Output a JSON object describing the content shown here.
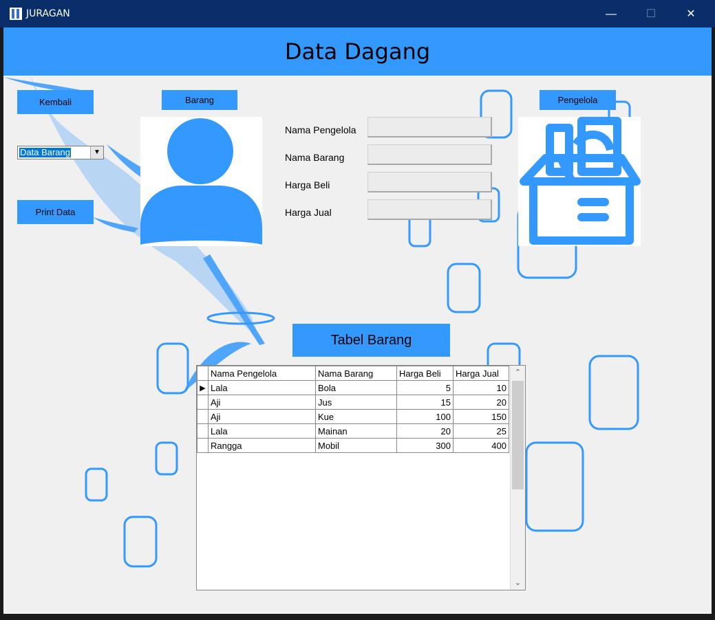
{
  "window": {
    "title": "JURAGAN",
    "minimize_symbol": "—",
    "maximize_symbol": "☐",
    "close_symbol": "✕"
  },
  "header": {
    "title": "Data Dagang"
  },
  "buttons": {
    "kembali": "Kembali",
    "barang": "Barang",
    "pengelola": "Pengelola",
    "print_data": "Print Data"
  },
  "combo": {
    "selected": "Data Barang",
    "arrow_symbol": "▼"
  },
  "form": {
    "labels": [
      "Nama Pengelola",
      "Nama Barang",
      "Harga Beli",
      "Harga Jual"
    ],
    "values": [
      "",
      "",
      "",
      ""
    ]
  },
  "table": {
    "title": "Tabel Barang",
    "columns": [
      "Nama Pengelola",
      "Nama Barang",
      "Harga Beli",
      "Harga Jual"
    ],
    "rows": [
      [
        "Lala",
        "Bola",
        "5",
        "10"
      ],
      [
        "Aji",
        "Jus",
        "15",
        "20"
      ],
      [
        "Aji",
        "Kue",
        "100",
        "150"
      ],
      [
        "Lala",
        "Mainan",
        "20",
        "25"
      ],
      [
        "Rangga",
        "Mobil",
        "300",
        "400"
      ]
    ],
    "current_row_marker": "▶",
    "scroll_up_symbol": "⌃",
    "scroll_down_symbol": "⌄"
  },
  "colors": {
    "accent": "#3399ff",
    "titlebar": "#0a2e6a",
    "background": "#f0f0f0"
  },
  "icons": {
    "person": "person-silhouette-icon",
    "box": "shopping-box-icon",
    "app": "app-logo-icon"
  }
}
